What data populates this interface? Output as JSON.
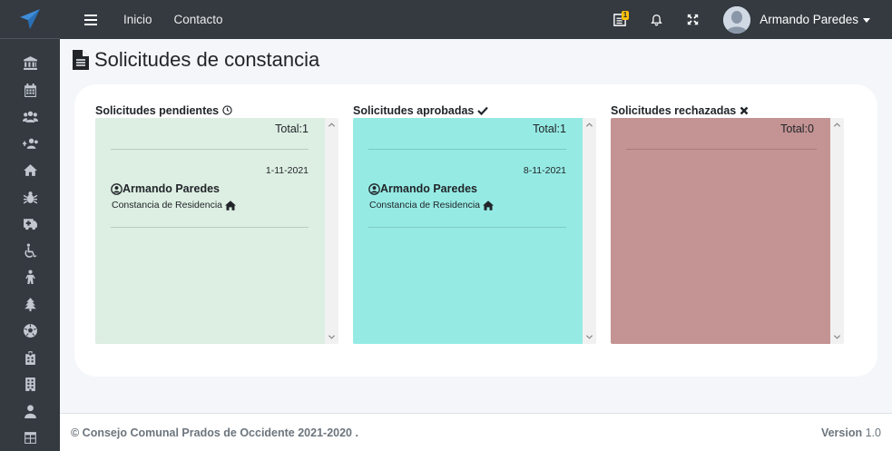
{
  "brand": {
    "icon": "paper-plane-icon",
    "color": "#3f8cd8"
  },
  "sidebar": {
    "icons": [
      "bank-icon",
      "calendar-icon",
      "users-icon",
      "user-plus-icon",
      "home-icon",
      "bug-icon",
      "ambulance-icon",
      "wheelchair-icon",
      "child-icon",
      "tree-icon",
      "soccer-ball-icon",
      "hospital-icon",
      "building-icon",
      "user-icon",
      "table-icon"
    ]
  },
  "navbar": {
    "links": [
      "Inicio",
      "Contacto"
    ],
    "notifications_badge": "1",
    "user_name": "Armando Paredes"
  },
  "page": {
    "title": "Solicitudes de constancia"
  },
  "columns": [
    {
      "title": "Solicitudes pendientes",
      "icon": "clock-icon",
      "color": "#ddeee3",
      "total": "Total:1",
      "items": [
        {
          "date": "1-11-2021",
          "name": "Armando Paredes",
          "type": "Constancia de Residencia"
        }
      ]
    },
    {
      "title": "Solicitudes aprobadas",
      "icon": "check-icon",
      "color": "#95ebe4",
      "total": "Total:1",
      "items": [
        {
          "date": "8-11-2021",
          "name": "Armando Paredes",
          "type": "Constancia de Residencia"
        }
      ]
    },
    {
      "title": "Solicitudes rechazadas",
      "icon": "times-icon",
      "color": "#c49393",
      "total": "Total:0",
      "items": []
    }
  ],
  "footer": {
    "copyright": "© Consejo Comunal Prados de Occidente 2021-2020 .",
    "version_label": "Version",
    "version_number": "1.0"
  }
}
